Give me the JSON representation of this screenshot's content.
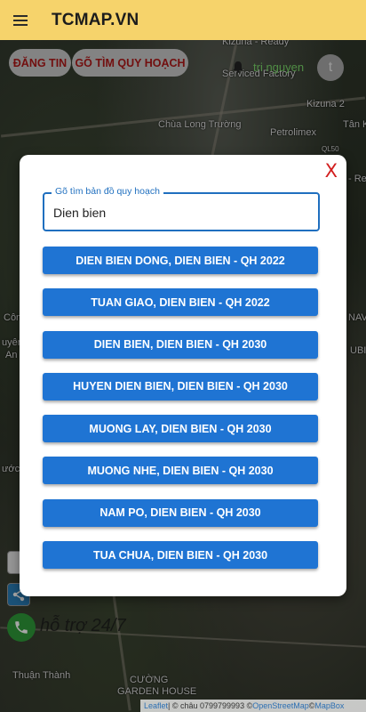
{
  "header": {
    "brand": "TCMAP.VN"
  },
  "toolbar": {
    "post_label": "ĐĂNG TIN",
    "search_plan_label": "GÕ TÌM QUY HOẠCH"
  },
  "user": {
    "name": "tri nguyen",
    "avatar_letter": "t"
  },
  "map_labels": {
    "kizuna_top": "Kizuna - Ready",
    "serviced_factory": "Serviced Factory",
    "kizuna2": "Kizuna 2",
    "tan_k": "Tân K",
    "chua": "Chùa Long Trường",
    "petrolimex": "Petrolimex",
    "ql50": "QL50",
    "con": "Côn",
    "uyen": "uyên",
    "an": "An",
    "uoc": "ước",
    "nav": "NAV",
    "ubi": "UBI",
    "re": "- Re",
    "thuan_thanh": "Thuận Thành",
    "cuong": "CƯỜNG",
    "garden_house": "GARDEN HOUSE"
  },
  "support": {
    "text": "hỗ trợ 24/7"
  },
  "attribution": {
    "leaflet": "Leaflet",
    "middle": " | © châu 0799799993 © ",
    "osm": "OpenStreetMap",
    "sep": " © ",
    "mapbox": "MapBox"
  },
  "modal": {
    "close_label": "X",
    "search": {
      "label": "Gõ tìm bản đồ quy hoạch",
      "value": "Dien bien"
    },
    "results": [
      "DIEN BIEN DONG, DIEN BIEN - QH 2022",
      "TUAN GIAO, DIEN BIEN - QH 2022",
      "DIEN BIEN, DIEN BIEN - QH 2030",
      "HUYEN DIEN BIEN, DIEN BIEN - QH 2030",
      "MUONG LAY, DIEN BIEN - QH 2030",
      "MUONG NHE, DIEN BIEN - QH 2030",
      "NAM PO, DIEN BIEN - QH 2030",
      "TUA CHUA, DIEN BIEN - QH 2030"
    ]
  },
  "colors": {
    "header_bg": "#f6d36b",
    "button_blue": "#1f74d3",
    "close_red": "#d21e1e",
    "username_green": "#7bd96a"
  }
}
